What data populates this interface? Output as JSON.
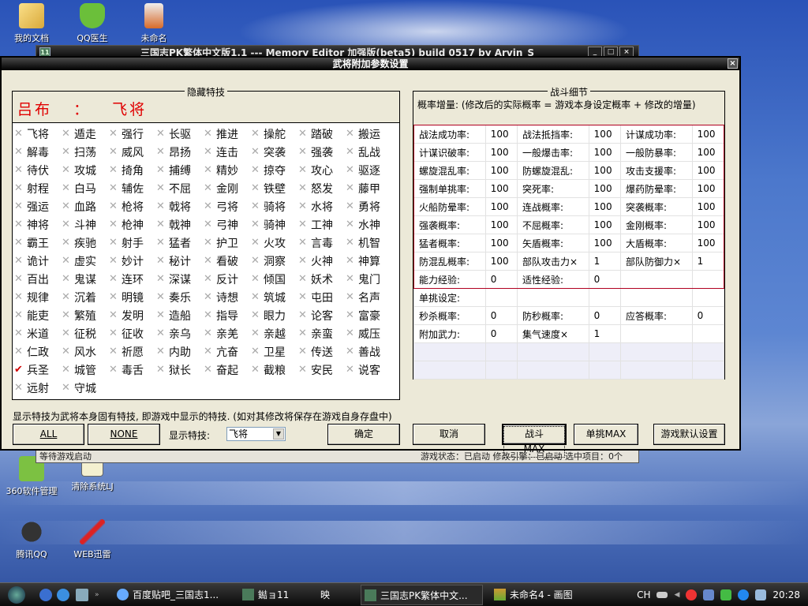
{
  "desktop": {
    "icons": [
      {
        "label": "我的文档",
        "icon": "folder-icon"
      },
      {
        "label": "QQ医生",
        "icon": "shield-icon"
      },
      {
        "label": "未命名",
        "icon": "image-file-icon"
      },
      {
        "label": "360软件管理",
        "icon": "software-manager-icon"
      },
      {
        "label": "清除系统LJ",
        "icon": "cleaner-icon"
      },
      {
        "label": "腾讯QQ",
        "icon": "qq-penguin-icon"
      },
      {
        "label": "WEB迅雷",
        "icon": "thunder-icon"
      }
    ]
  },
  "bg_window": {
    "title": "三国志PK繁体中文版1.1 --- Memory Editor 加强版(beta5) build 0517 by Arvin_S",
    "icon_text": "11",
    "status_left": "等待游戏启动",
    "status_right": "游戏状态：已启动  修改引擎：已启动  选中项目：0个"
  },
  "dialog": {
    "title": "武将附加参数设置",
    "close_glyph": "×",
    "hidden_skills": {
      "legend": "隐藏特技",
      "hero_name": "吕布",
      "separator": "：",
      "hero_skill": "飞将",
      "skills": [
        {
          "name": "飞将",
          "checked": false
        },
        {
          "name": "遁走",
          "checked": false
        },
        {
          "name": "强行",
          "checked": false
        },
        {
          "name": "长驱",
          "checked": false
        },
        {
          "name": "推进",
          "checked": false
        },
        {
          "name": "操舵",
          "checked": false
        },
        {
          "name": "踏破",
          "checked": false
        },
        {
          "name": "搬运",
          "checked": false
        },
        {
          "name": "解毒",
          "checked": false
        },
        {
          "name": "扫荡",
          "checked": false
        },
        {
          "name": "威风",
          "checked": false
        },
        {
          "name": "昂扬",
          "checked": false
        },
        {
          "name": "连击",
          "checked": false
        },
        {
          "name": "突袭",
          "checked": false
        },
        {
          "name": "强袭",
          "checked": false
        },
        {
          "name": "乱战",
          "checked": false
        },
        {
          "name": "待伏",
          "checked": false
        },
        {
          "name": "攻城",
          "checked": false
        },
        {
          "name": "掎角",
          "checked": false
        },
        {
          "name": "捕缚",
          "checked": false
        },
        {
          "name": "精妙",
          "checked": false
        },
        {
          "name": "掠夺",
          "checked": false
        },
        {
          "name": "攻心",
          "checked": false
        },
        {
          "name": "驱逐",
          "checked": false
        },
        {
          "name": "射程",
          "checked": false
        },
        {
          "name": "白马",
          "checked": false
        },
        {
          "name": "辅佐",
          "checked": false
        },
        {
          "name": "不屈",
          "checked": false
        },
        {
          "name": "金刚",
          "checked": false
        },
        {
          "name": "铁壁",
          "checked": false
        },
        {
          "name": "怒发",
          "checked": false
        },
        {
          "name": "藤甲",
          "checked": false
        },
        {
          "name": "强运",
          "checked": false
        },
        {
          "name": "血路",
          "checked": false
        },
        {
          "name": "枪将",
          "checked": false
        },
        {
          "name": "戟将",
          "checked": false
        },
        {
          "name": "弓将",
          "checked": false
        },
        {
          "name": "骑将",
          "checked": false
        },
        {
          "name": "水将",
          "checked": false
        },
        {
          "name": "勇将",
          "checked": false
        },
        {
          "name": "神将",
          "checked": false
        },
        {
          "name": "斗神",
          "checked": false
        },
        {
          "name": "枪神",
          "checked": false
        },
        {
          "name": "戟神",
          "checked": false
        },
        {
          "name": "弓神",
          "checked": false
        },
        {
          "name": "骑神",
          "checked": false
        },
        {
          "name": "工神",
          "checked": false
        },
        {
          "name": "水神",
          "checked": false
        },
        {
          "name": "霸王",
          "checked": false
        },
        {
          "name": "疾驰",
          "checked": false
        },
        {
          "name": "射手",
          "checked": false
        },
        {
          "name": "猛者",
          "checked": false
        },
        {
          "name": "护卫",
          "checked": false
        },
        {
          "name": "火攻",
          "checked": false
        },
        {
          "name": "言毒",
          "checked": false
        },
        {
          "name": "机智",
          "checked": false
        },
        {
          "name": "诡计",
          "checked": false
        },
        {
          "name": "虚实",
          "checked": false
        },
        {
          "name": "妙计",
          "checked": false
        },
        {
          "name": "秘计",
          "checked": false
        },
        {
          "name": "看破",
          "checked": false
        },
        {
          "name": "洞察",
          "checked": false
        },
        {
          "name": "火神",
          "checked": false
        },
        {
          "name": "神算",
          "checked": false
        },
        {
          "name": "百出",
          "checked": false
        },
        {
          "name": "鬼谋",
          "checked": false
        },
        {
          "name": "连环",
          "checked": false
        },
        {
          "name": "深谋",
          "checked": false
        },
        {
          "name": "反计",
          "checked": false
        },
        {
          "name": "倾国",
          "checked": false
        },
        {
          "name": "妖术",
          "checked": false
        },
        {
          "name": "鬼门",
          "checked": false
        },
        {
          "name": "规律",
          "checked": false
        },
        {
          "name": "沉着",
          "checked": false
        },
        {
          "name": "明镜",
          "checked": false
        },
        {
          "name": "奏乐",
          "checked": false
        },
        {
          "name": "诗想",
          "checked": false
        },
        {
          "name": "筑城",
          "checked": false
        },
        {
          "name": "屯田",
          "checked": false
        },
        {
          "name": "名声",
          "checked": false
        },
        {
          "name": "能吏",
          "checked": false
        },
        {
          "name": "繁殖",
          "checked": false
        },
        {
          "name": "发明",
          "checked": false
        },
        {
          "name": "造船",
          "checked": false
        },
        {
          "name": "指导",
          "checked": false
        },
        {
          "name": "眼力",
          "checked": false
        },
        {
          "name": "论客",
          "checked": false
        },
        {
          "name": "富豪",
          "checked": false
        },
        {
          "name": "米道",
          "checked": false
        },
        {
          "name": "征税",
          "checked": false
        },
        {
          "name": "征收",
          "checked": false
        },
        {
          "name": "亲乌",
          "checked": false
        },
        {
          "name": "亲羌",
          "checked": false
        },
        {
          "name": "亲越",
          "checked": false
        },
        {
          "name": "亲蛮",
          "checked": false
        },
        {
          "name": "威压",
          "checked": false
        },
        {
          "name": "仁政",
          "checked": false
        },
        {
          "name": "风水",
          "checked": false
        },
        {
          "name": "祈愿",
          "checked": false
        },
        {
          "name": "内助",
          "checked": false
        },
        {
          "name": "亢奋",
          "checked": false
        },
        {
          "name": "卫星",
          "checked": false
        },
        {
          "name": "传送",
          "checked": false
        },
        {
          "name": "善战",
          "checked": false
        },
        {
          "name": "兵圣",
          "checked": true
        },
        {
          "name": "城管",
          "checked": false
        },
        {
          "name": "毒舌",
          "checked": false
        },
        {
          "name": "狱长",
          "checked": false
        },
        {
          "name": "奋起",
          "checked": false
        },
        {
          "name": "截粮",
          "checked": false
        },
        {
          "name": "安民",
          "checked": false
        },
        {
          "name": "说客",
          "checked": false
        },
        {
          "name": "远射",
          "checked": false
        },
        {
          "name": "守城",
          "checked": false
        }
      ]
    },
    "note": "显示特技为武将本身固有特技, 即游戏中显示的特技. (如对其修改将保存在游戏自身存盘中)",
    "buttons": {
      "all": "ALL",
      "none": "NONE",
      "ok": "确定",
      "cancel": "取消",
      "battle_max": "战斗MAX",
      "duel_max": "单挑MAX",
      "defaults": "游戏默认设置"
    },
    "display_skill_label": "显示特技:",
    "display_skill_value": "飞将",
    "battle": {
      "legend": "战斗细节",
      "description": "概率增量: (修改后的实际概率 = 游戏本身设定概率 + 修改的增量)",
      "rows": [
        [
          {
            "label": "战法成功率:",
            "value": "100"
          },
          {
            "label": "战法抵挡率:",
            "value": "100"
          },
          {
            "label": "计谋成功率:",
            "value": "100"
          }
        ],
        [
          {
            "label": "计谋识破率:",
            "value": "100"
          },
          {
            "label": "一般爆击率:",
            "value": "100"
          },
          {
            "label": "一般防暴率:",
            "value": "100"
          }
        ],
        [
          {
            "label": "螺旋混乱率:",
            "value": "100"
          },
          {
            "label": "防螺旋混乱:",
            "value": "100"
          },
          {
            "label": "攻击支援率:",
            "value": "100"
          }
        ],
        [
          {
            "label": "强制单挑率:",
            "value": "100"
          },
          {
            "label": "突死率:",
            "value": "100"
          },
          {
            "label": "爆药防晕率:",
            "value": "100"
          }
        ],
        [
          {
            "label": "火船防晕率:",
            "value": "100"
          },
          {
            "label": "连战概率:",
            "value": "100"
          },
          {
            "label": "突袭概率:",
            "value": "100"
          }
        ],
        [
          {
            "label": "强袭概率:",
            "value": "100"
          },
          {
            "label": "不屈概率:",
            "value": "100"
          },
          {
            "label": "金刚概率:",
            "value": "100"
          }
        ],
        [
          {
            "label": "猛者概率:",
            "value": "100"
          },
          {
            "label": "矢盾概率:",
            "value": "100"
          },
          {
            "label": "大盾概率:",
            "value": "100"
          }
        ],
        [
          {
            "label": "防混乱概率:",
            "value": "100"
          },
          {
            "label": "部队攻击力×",
            "value": "1"
          },
          {
            "label": "部队防御力×",
            "value": "1"
          }
        ],
        [
          {
            "label": "能力经验:",
            "value": "0"
          },
          {
            "label": "适性经验:",
            "value": "0"
          },
          {
            "label": "",
            "value": ""
          }
        ],
        [
          {
            "label": "单挑设定:",
            "value": ""
          },
          {
            "label": "",
            "value": ""
          },
          {
            "label": "",
            "value": ""
          }
        ],
        [
          {
            "label": "秒杀概率:",
            "value": "0"
          },
          {
            "label": "防秒概率:",
            "value": "0"
          },
          {
            "label": "应答概率:",
            "value": "0"
          }
        ],
        [
          {
            "label": "附加武力:",
            "value": "0"
          },
          {
            "label": "集气速度×",
            "value": "1"
          },
          {
            "label": "",
            "value": ""
          }
        ]
      ]
    }
  },
  "taskbar": {
    "tasks": [
      {
        "label": "百度贴吧_三国志1...",
        "icon": "browser-icon"
      },
      {
        "label": "鐑ョ11",
        "icon": "game-icon"
      },
      {
        "label": "映",
        "icon": ""
      },
      {
        "label": "三国志PK繁体中文...",
        "icon": "game-icon",
        "active": true
      },
      {
        "label": "未命名4 - 画图",
        "icon": "paint-icon"
      }
    ],
    "language": "CH",
    "clock": "20:28"
  },
  "colors": {
    "hero_red": "#e00000",
    "check_red": "#d00000",
    "highlight_border": "#b00020",
    "dialog_bg": "#ece9d8"
  }
}
